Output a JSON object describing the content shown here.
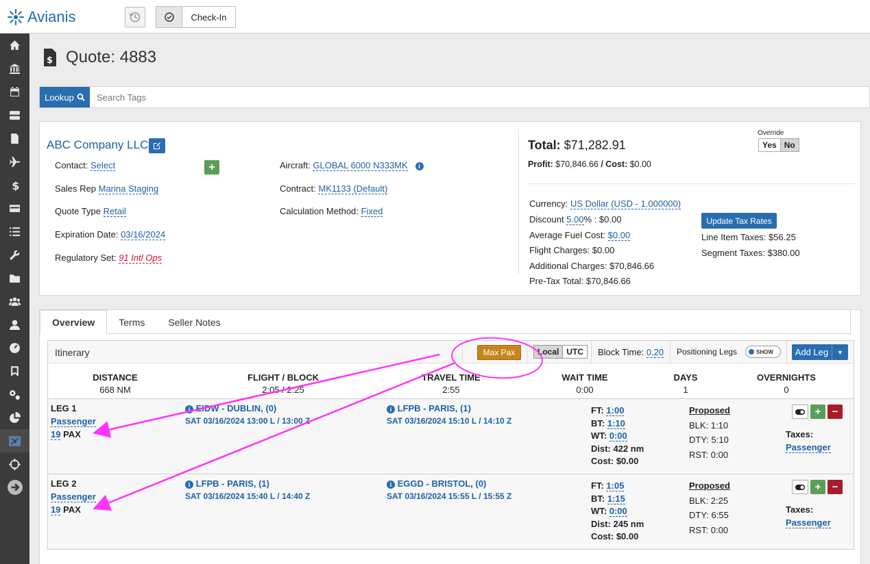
{
  "app": {
    "brand": "Avianis",
    "checkin_label": "Check-In"
  },
  "sidebar": {
    "items": [
      "home-icon",
      "bank-icon",
      "calendar-icon",
      "server-icon",
      "invoice-icon",
      "plane-icon",
      "dollar-icon",
      "card-icon",
      "list-icon",
      "wrench-icon",
      "folder-icon",
      "users-icon",
      "user-icon",
      "dashboard-icon",
      "bookmark-icon",
      "cogs-icon",
      "pie-chart-icon",
      "flight-board-icon",
      "crosshair-icon",
      "arrow-right-icon"
    ]
  },
  "page": {
    "title": "Quote: 4883"
  },
  "lookup": {
    "button": "Lookup",
    "placeholder": "Search Tags"
  },
  "quote": {
    "company": "ABC Company LLC",
    "contact_label": "Contact:",
    "contact_value": "Select",
    "salesrep_label": "Sales Rep",
    "salesrep_value": "Marina Staging",
    "quotetype_label": "Quote Type",
    "quotetype_value": "Retail",
    "expiration_label": "Expiration Date:",
    "expiration_value": "03/16/2024",
    "regset_label": "Regulatory Set:",
    "regset_value": "91 Intl Ops",
    "aircraft_label": "Aircraft:",
    "aircraft_value": "GLOBAL 6000 N333MK",
    "contract_label": "Contract:",
    "contract_value": "MK1133 (Default)",
    "calc_label": "Calculation Method:",
    "calc_value": "Fixed",
    "total_label": "Total:",
    "total_value": "$71,282.91",
    "profit_label": "Profit:",
    "profit_value": "$70,846.66",
    "cost_label": "/ Cost:",
    "cost_value": "$0.00",
    "override_label": "Override",
    "override_yes": "Yes",
    "override_no": "No",
    "currency_label": "Currency:",
    "currency_value": "US Dollar (USD - 1.000000)",
    "discount_label": "Discount",
    "discount_pct": "5.00",
    "discount_rest": "% : $0.00",
    "fuel_label": "Average Fuel Cost:",
    "fuel_value": "$0.00",
    "flight_charges": "Flight Charges: $0.00",
    "additional_charges": "Additional Charges: $70,846.66",
    "pretax_total": "Pre-Tax Total: $70,846.66",
    "update_tax_btn": "Update Tax Rates",
    "line_item_taxes": "Line Item Taxes: $56.25",
    "segment_taxes": "Segment Taxes: $380.00"
  },
  "tabs": [
    {
      "label": "Overview"
    },
    {
      "label": "Terms"
    },
    {
      "label": "Seller Notes"
    }
  ],
  "itinerary": {
    "title": "Itinerary",
    "max_pax": "Max Pax",
    "local": "Local",
    "utc": "UTC",
    "block_time_label": "Block Time:",
    "block_time_value": "0.20",
    "positioning_label": "Positioning Legs",
    "toggle_label": "SHOW",
    "add_leg": "Add Leg",
    "summary": [
      {
        "h": "DISTANCE",
        "v": "668 NM"
      },
      {
        "h": "FLIGHT / BLOCK",
        "v": "2:05 / 2:25"
      },
      {
        "h": "TRAVEL TIME",
        "v": "2:55"
      },
      {
        "h": "WAIT TIME",
        "v": "0:00"
      },
      {
        "h": "DAYS",
        "v": "1"
      },
      {
        "h": "OVERNIGHTS",
        "v": "0"
      }
    ],
    "legs": [
      {
        "name": "LEG 1",
        "type": "Passenger",
        "pax": "19",
        "pax_label": "PAX",
        "from": "EIDW - DUBLIN, (0)",
        "from_dt": "SAT 03/16/2024 13:00 L / 13:00 Z",
        "to": "LFPB - PARIS, (1)",
        "to_dt": "SAT 03/16/2024 15:10 L / 14:10 Z",
        "ft_label": "FT:",
        "ft": "1:00",
        "bt_label": "BT:",
        "bt": "1:10",
        "wt_label": "WT:",
        "wt": "0:00",
        "dist": "Dist: 422 nm",
        "cost": "Cost: $0.00",
        "proposed": "Proposed",
        "blk": "BLK: 1:10",
        "dty": "DTY: 5:10",
        "rst": "RST: 0:00",
        "taxes_label": "Taxes:",
        "taxes_value": "Passenger"
      },
      {
        "name": "LEG 2",
        "type": "Passenger",
        "pax": "19",
        "pax_label": "PAX",
        "from": "LFPB - PARIS, (1)",
        "from_dt": "SAT 03/16/2024 15:40 L / 14:40 Z",
        "to": "EGGD - BRISTOL, (0)",
        "to_dt": "SAT 03/16/2024 15:55 L / 15:55 Z",
        "ft_label": "FT:",
        "ft": "1:05",
        "bt_label": "BT:",
        "bt": "1:15",
        "wt_label": "WT:",
        "wt": "0:00",
        "dist": "Dist: 245 nm",
        "cost": "Cost: $0.00",
        "proposed": "Proposed",
        "blk": "BLK: 2:25",
        "dty": "DTY: 6:55",
        "rst": "RST: 0:00",
        "taxes_label": "Taxes:",
        "taxes_value": "Passenger"
      }
    ]
  },
  "colors": {
    "accent": "#2a6db0",
    "sidebar": "#3b3b3b",
    "max_pax": "#c8841c",
    "annotation": "#ff33ff",
    "danger": "#a81c2c",
    "success": "#5a9e5a"
  }
}
